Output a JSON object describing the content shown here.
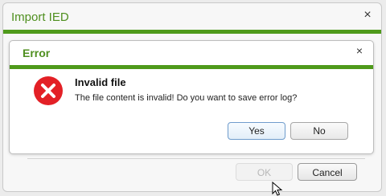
{
  "outer_dialog": {
    "title": "Import IED",
    "close_glyph": "×",
    "ok_label": "OK",
    "cancel_label": "Cancel",
    "accent_color": "#4f9a1b"
  },
  "error_dialog": {
    "title": "Error",
    "close_glyph": "×",
    "icon": "error-x-circle-icon",
    "icon_color": "#e32026",
    "heading": "Invalid file",
    "message": "The file content is invalid! Do you want to save error log?",
    "yes_label": "Yes",
    "no_label": "No"
  }
}
